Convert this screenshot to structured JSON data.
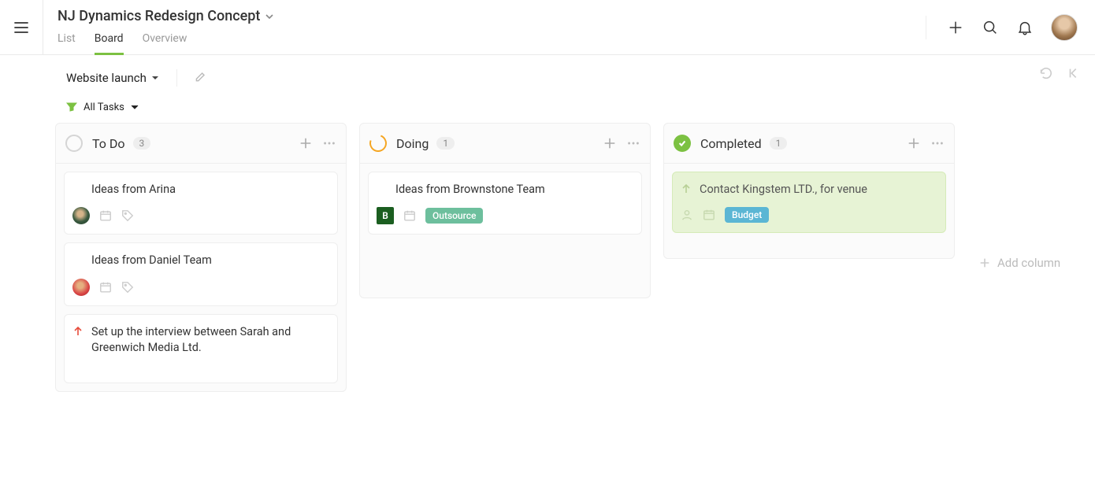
{
  "header": {
    "title": "NJ Dynamics Redesign Concept",
    "tabs": {
      "list": "List",
      "board": "Board",
      "overview": "Overview"
    }
  },
  "toolbar": {
    "view_name": "Website launch",
    "filter_label": "All Tasks"
  },
  "columns": {
    "todo": {
      "title": "To Do",
      "count": "3"
    },
    "doing": {
      "title": "Doing",
      "count": "1"
    },
    "done": {
      "title": "Completed",
      "count": "1"
    }
  },
  "add_column_label": "Add column",
  "cards": {
    "todo": [
      {
        "title": "Ideas from Arina"
      },
      {
        "title": "Ideas from Daniel Team"
      },
      {
        "title": "Set up the interview between Sarah and Greenwich Media Ltd."
      }
    ],
    "doing": [
      {
        "title": "Ideas from Brownstone Team",
        "square_avatar": "B",
        "tag": "Outsource"
      }
    ],
    "done": [
      {
        "title": "Contact Kingstem LTD., for venue",
        "tag": "Budget"
      }
    ]
  }
}
